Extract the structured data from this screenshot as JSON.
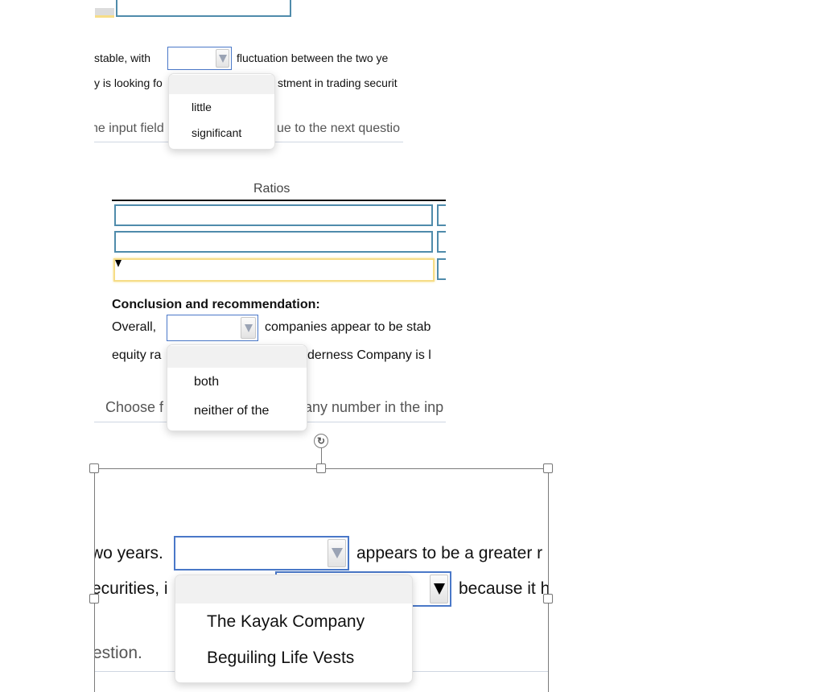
{
  "section1": {
    "line1_before": "stable, with",
    "line1_after": "fluctuation between the two ye",
    "line2_before": "y is looking fo",
    "line2_after": "stment in trading securit",
    "hint": "he input field",
    "hint_after": "ue to the next questio",
    "dropdown_options": [
      "little",
      "significant"
    ]
  },
  "ratios": {
    "header": "Ratios"
  },
  "conclusion": {
    "heading": "Conclusion and recommendation:",
    "line1_before": "Overall,",
    "line1_after": "companies appear to be stab",
    "line2_before": "equity ra",
    "line2_after": "derness Company is l",
    "hint_before": "Choose f",
    "hint_after": "any number in the inp",
    "dropdown_options": [
      "both",
      "neither of the"
    ]
  },
  "zoomed": {
    "line1_before": "wo years.",
    "line1_after": "appears to be a greater r",
    "line2_before": "ecurities, i",
    "line2_after": "because it h",
    "hint": "estion.",
    "dropdown_options": [
      "The Kayak Company",
      "Beguiling Life Vests"
    ]
  },
  "icons": {
    "rotate": "↻"
  }
}
